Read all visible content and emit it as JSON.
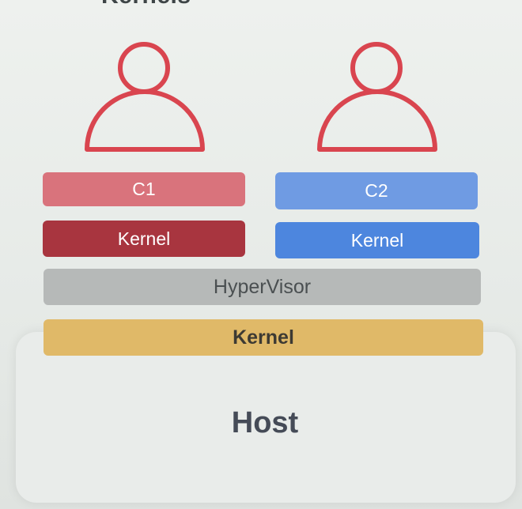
{
  "header": {
    "title": "Kernels"
  },
  "users": [
    {
      "icon": "person-icon",
      "color": "#d9454f"
    },
    {
      "icon": "person-icon",
      "color": "#d9454f"
    }
  ],
  "guests": [
    {
      "container_label": "C1",
      "kernel_label": "Kernel"
    },
    {
      "container_label": "C2",
      "kernel_label": "Kernel"
    }
  ],
  "hypervisor": {
    "label": "HyperVisor"
  },
  "host": {
    "kernel_label": "Kernel",
    "label": "Host"
  },
  "colors": {
    "c1": "#d9737c",
    "kernel1": "#a8353f",
    "c2": "#6f9be3",
    "kernel2": "#4d86de",
    "hypervisor": "#b6b9b8",
    "host_kernel": "#e0b968"
  }
}
